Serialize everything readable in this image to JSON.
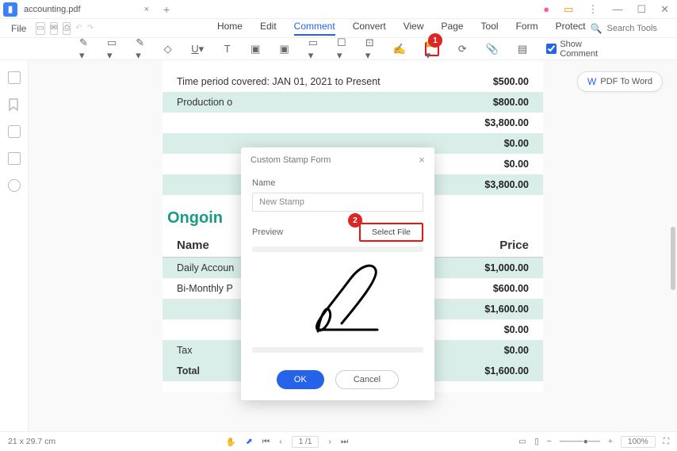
{
  "titlebar": {
    "filename": "accounting.pdf"
  },
  "menubar": {
    "file": "File",
    "tabs": [
      "Home",
      "Edit",
      "Comment",
      "Convert",
      "View",
      "Page",
      "Tool",
      "Form",
      "Protect"
    ],
    "active_tab": "Comment",
    "search_placeholder": "Search Tools"
  },
  "toolbar": {
    "show_comment": "Show Comment",
    "badge1": "1"
  },
  "pdf_to_word": "PDF To Word",
  "doc": {
    "rows_top": [
      {
        "label": "Time period covered: JAN 01, 2021 to Present",
        "val": "$500.00",
        "alt": false
      },
      {
        "label": "Production o",
        "val": "$800.00",
        "alt": true
      },
      {
        "label": "",
        "val": "$3,800.00",
        "alt": false
      },
      {
        "label": "",
        "val": "$0.00",
        "alt": true
      },
      {
        "label": "",
        "val": "$0.00",
        "alt": false
      },
      {
        "label": "",
        "val": "$3,800.00",
        "alt": true
      }
    ],
    "section_title": "Ongoin",
    "thead": {
      "name": "Name",
      "price": "Price"
    },
    "rows_bottom": [
      {
        "label": "Daily Accoun",
        "val": "$1,000.00",
        "alt": true
      },
      {
        "label": "Bi-Monthly P",
        "val": "$600.00",
        "alt": false
      },
      {
        "label": "",
        "val": "$1,600.00",
        "alt": true
      },
      {
        "label": "",
        "val": "$0.00",
        "alt": false
      },
      {
        "label": "Tax",
        "val": "$0.00",
        "alt": true
      },
      {
        "label": "Total",
        "val": "$1,600.00",
        "alt": true,
        "bold": true
      }
    ]
  },
  "dialog": {
    "title": "Custom Stamp Form",
    "name_label": "Name",
    "name_value": "New Stamp",
    "preview_label": "Preview",
    "select_file": "Select File",
    "badge2": "2",
    "ok": "OK",
    "cancel": "Cancel"
  },
  "statusbar": {
    "dimensions": "21 x 29.7 cm",
    "page": "1 /1",
    "zoom": "100%"
  }
}
